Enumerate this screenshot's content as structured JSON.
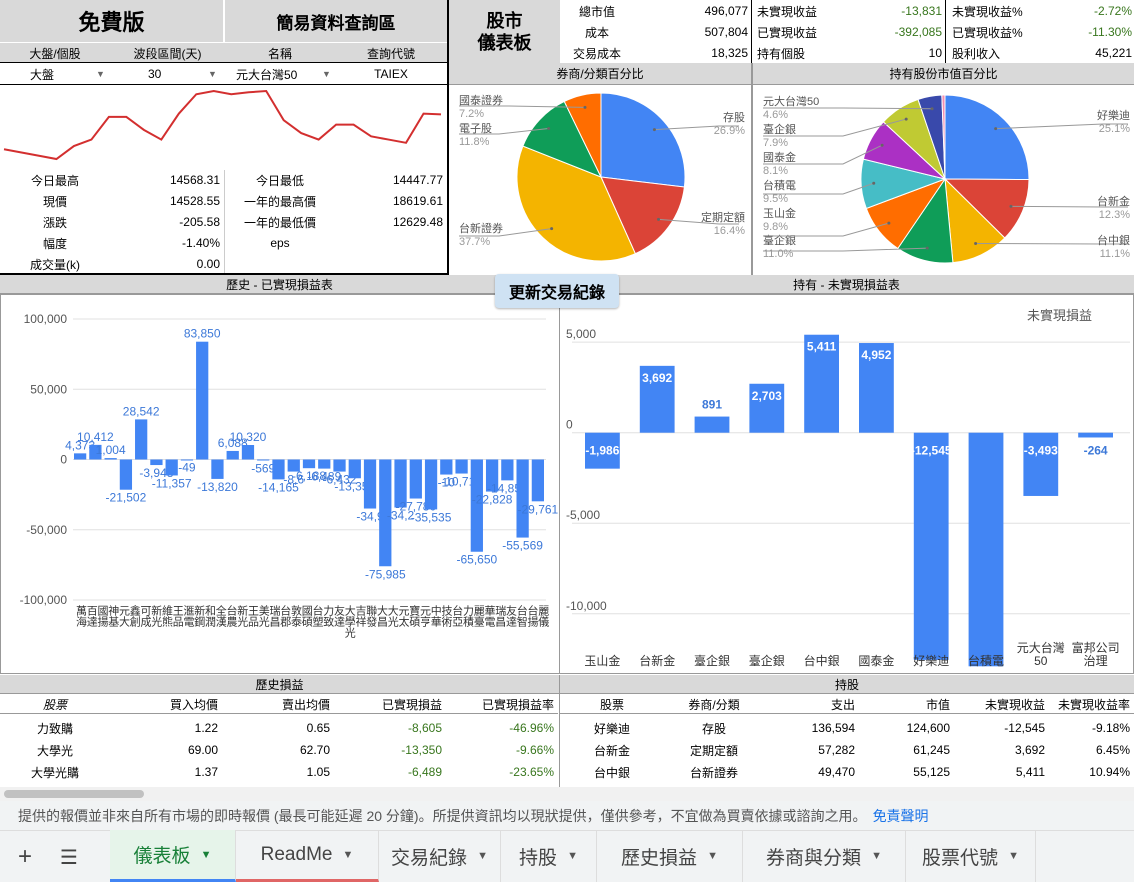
{
  "header": {
    "free_label": "免費版",
    "query_label": "簡易資料查詢區",
    "dashboard_label_1": "股市",
    "dashboard_label_2": "儀表板",
    "col1": "大盤/個股",
    "col2": "波段區間(天)",
    "col3": "名稱",
    "col4": "查詢代號",
    "val1": "大盤",
    "val2": "30",
    "val3": "元大台灣50",
    "val4": "TAIEX"
  },
  "summary": {
    "rows": [
      {
        "l1": "總市值",
        "v1": "496,077",
        "l2": "未實現收益",
        "v2": "-13,831",
        "l3": "未實現收益%",
        "v3": "-2.72%"
      },
      {
        "l1": "成本",
        "v1": "507,804",
        "l2": "已實現收益",
        "v2": "-392,085",
        "l3": "已實現收益%",
        "v3": "-11.30%"
      },
      {
        "l1": "交易成本",
        "v1": "18,325",
        "l2": "持有個股",
        "v2": "10",
        "l3": "股利收入",
        "v3": "45,221"
      }
    ]
  },
  "quote": {
    "left": [
      {
        "label": "今日最高",
        "value": "14568.31"
      },
      {
        "label": "現價",
        "value": "14528.55"
      },
      {
        "label": "漲跌",
        "value": "-205.58"
      },
      {
        "label": "幅度",
        "value": "-1.40%"
      },
      {
        "label": "成交量(k)",
        "value": "0.00"
      }
    ],
    "right": [
      {
        "label": "今日最低",
        "value": "14447.77"
      },
      {
        "label": "一年的最高價",
        "value": "18619.61"
      },
      {
        "label": "一年的最低價",
        "value": "12629.48"
      },
      {
        "label": "eps",
        "value": ""
      }
    ]
  },
  "pie1": {
    "title": "券商/分類百分比",
    "slices": [
      {
        "name": "存股",
        "pct": "26.9%",
        "value": 26.9,
        "color": "#4285f4"
      },
      {
        "name": "定期定額",
        "pct": "16.4%",
        "value": 16.4,
        "color": "#db4437"
      },
      {
        "name": "台新證券",
        "pct": "37.7%",
        "value": 37.7,
        "color": "#f4b400"
      },
      {
        "name": "電子股",
        "pct": "11.8%",
        "value": 11.8,
        "color": "#0f9d58"
      },
      {
        "name": "國泰證券",
        "pct": "7.2%",
        "value": 7.2,
        "color": "#ff6d00"
      }
    ]
  },
  "pie2": {
    "title": "持有股份市值百分比",
    "slices": [
      {
        "name": "好樂迪",
        "pct": "25.1%",
        "value": 25.1,
        "color": "#4285f4"
      },
      {
        "name": "台新金",
        "pct": "12.3%",
        "value": 12.3,
        "color": "#db4437"
      },
      {
        "name": "台中銀",
        "pct": "11.1%",
        "value": 11.1,
        "color": "#f4b400"
      },
      {
        "name": "臺企銀",
        "pct": "11.0%",
        "value": 11.0,
        "color": "#0f9d58"
      },
      {
        "name": "玉山金",
        "pct": "9.8%",
        "value": 9.8,
        "color": "#ff6d00"
      },
      {
        "name": "台積電",
        "pct": "9.5%",
        "value": 9.5,
        "color": "#46bdc6"
      },
      {
        "name": "國泰金",
        "pct": "8.1%",
        "value": 8.1,
        "color": "#ab30c4"
      },
      {
        "name": "臺企銀",
        "pct": "7.9%",
        "value": 7.9,
        "color": "#c0ca33"
      },
      {
        "name": "元大台灣50",
        "pct": "4.6%",
        "value": 4.6,
        "color": "#3949ab"
      },
      {
        "name": "",
        "pct": "",
        "value": 0.6,
        "color": "#f48fb1"
      }
    ]
  },
  "update_button": "更新交易紀錄",
  "realized_chart": {
    "title": "歷史 - 已實現損益表"
  },
  "unrealized_chart": {
    "title": "持有 - 未實現損益表",
    "legend": "未實現損益"
  },
  "chart_data": [
    {
      "type": "line",
      "title": "",
      "series": [
        {
          "name": "",
          "values": [
            14000,
            13950,
            13900,
            13850,
            14050,
            14150,
            14500,
            14500,
            14300,
            14150,
            14550,
            14850,
            14900,
            14850,
            14880,
            14900,
            14450,
            14250,
            14150,
            14380,
            14380,
            14200,
            14150,
            14100,
            14550,
            14540
          ]
        }
      ]
    },
    {
      "type": "bar",
      "title": "歷史 - 已實現損益表",
      "ylim": [
        -100000,
        100000
      ],
      "y_ticks": [
        "100,000",
        "50,000",
        "0",
        "-50,000",
        "-100,000"
      ],
      "categories": [
        "萬海",
        "百達",
        "國揚",
        "神基",
        "元大",
        "鑫創",
        "可成",
        "新光",
        "維熊",
        "王品",
        "滙電",
        "新鋼",
        "和潤",
        "全漢",
        "台農",
        "新光",
        "王品",
        "美光",
        "瑞昌",
        "台郡",
        "敦泰",
        "國碩",
        "台塑",
        "力致",
        "友達",
        "大學光",
        "吉祥",
        "聯發",
        "大昌",
        "大光",
        "元太",
        "寶碩",
        "元亨",
        "中華",
        "技術",
        "台亞",
        "力積",
        "麗臺",
        "華電",
        "瑞昌",
        "友達",
        "台智",
        "台揚",
        "麗儀"
      ],
      "values": [
        4373,
        10412,
        1004,
        -21502,
        28542,
        -3948,
        -11357,
        -49,
        83850,
        -13820,
        6088,
        10320,
        -569,
        -14165,
        -8600,
        -6188,
        -6489,
        -8605,
        -13350,
        -34900,
        -75985,
        -34200,
        -27780,
        -35535,
        -10716,
        -10000,
        -65650,
        -22828,
        -14850,
        -55569,
        -29761
      ],
      "data_labels": [
        "4,373",
        "10,412",
        "1,004",
        "-21,502",
        "28,542",
        "-3,948",
        "-11,357",
        "-49",
        "83,850",
        "-13,820",
        "6,088",
        "10,320",
        "-569",
        "-14,165",
        "-8,6",
        "-6,188",
        "-6,489",
        "-6,432",
        "-13,350",
        "-34,9",
        "-75,985",
        "-34,2",
        "-27,780",
        "-35,535",
        "-10",
        "-10,716",
        "-65,650",
        "-22,828",
        "-14,850",
        "-55,569",
        "-29,761"
      ]
    },
    {
      "type": "bar",
      "title": "持有 - 未實現損益表",
      "ylim": [
        -12000,
        6500
      ],
      "y_ticks": [
        "5,000",
        "0",
        "-5,000",
        "-10,000"
      ],
      "categories": [
        "玉山金",
        "台新金",
        "臺企銀",
        "臺企銀",
        "台中銀",
        "國泰金",
        "好樂迪",
        "台積電",
        "元大台灣50",
        "富邦公司治理"
      ],
      "series": [
        {
          "name": "未實現損益",
          "values": [
            -1986,
            3692,
            891,
            2703,
            5411,
            4952,
            -12545,
            -12900,
            -3493,
            -264
          ]
        }
      ],
      "data_labels": [
        "-1,986",
        "3,692",
        "891",
        "2,703",
        "5,411",
        "4,952",
        "-12,545",
        "",
        "-3,493",
        "-264"
      ]
    }
  ],
  "history_table": {
    "title": "歷史損益",
    "headers": [
      "股票",
      "買入均價",
      "賣出均價",
      "已實現損益",
      "已實現損益率"
    ],
    "rows": [
      [
        "力致購",
        "1.22",
        "0.65",
        "-8,605",
        "-46.96%"
      ],
      [
        "大學光",
        "69.00",
        "62.70",
        "-13,350",
        "-9.66%"
      ],
      [
        "大學光購",
        "1.37",
        "1.05",
        "-6,489",
        "-23.65%"
      ]
    ]
  },
  "holding_table": {
    "title": "持股",
    "headers": [
      "股票",
      "券商/分類",
      "支出",
      "市值",
      "未實現收益",
      "未實現收益率"
    ],
    "rows": [
      [
        "好樂迪",
        "存股",
        "136,594",
        "124,600",
        "-12,545",
        "-9.18%"
      ],
      [
        "台新金",
        "定期定額",
        "57,282",
        "61,245",
        "3,692",
        "6.45%"
      ],
      [
        "台中銀",
        "台新證券",
        "49,470",
        "55,125",
        "5,411",
        "10.94%"
      ]
    ]
  },
  "disclaimer": "提供的報價並非來自所有市場的即時報價 (最長可能延遲 20 分鐘)。所提供資訊均以現狀提供，僅供參考，不宜做為買賣依據或諮詢之用。",
  "disclaimer_link": "免責聲明",
  "tabs": [
    "儀表板",
    "ReadMe",
    "交易紀錄",
    "持股",
    "歷史損益",
    "券商與分類",
    "股票代號"
  ]
}
